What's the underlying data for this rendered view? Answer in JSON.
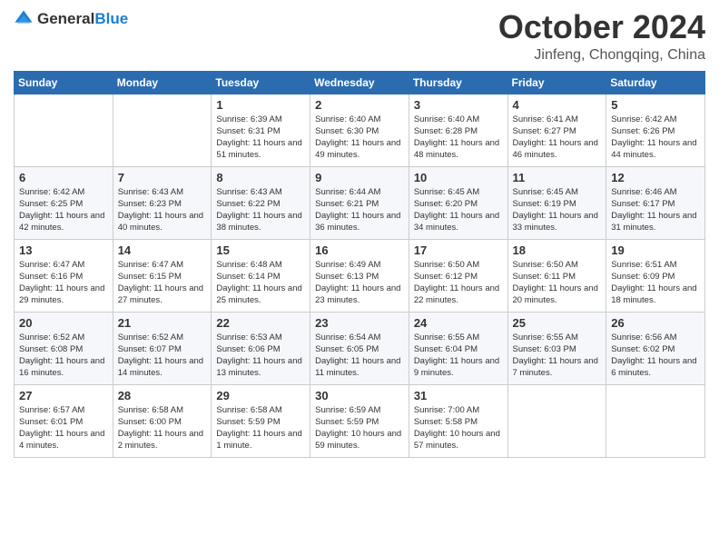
{
  "header": {
    "logo_general": "General",
    "logo_blue": "Blue",
    "title": "October 2024",
    "subtitle": "Jinfeng, Chongqing, China"
  },
  "days_header": [
    "Sunday",
    "Monday",
    "Tuesday",
    "Wednesday",
    "Thursday",
    "Friday",
    "Saturday"
  ],
  "weeks": [
    [
      {
        "day": "",
        "sunrise": "",
        "sunset": "",
        "daylight": ""
      },
      {
        "day": "",
        "sunrise": "",
        "sunset": "",
        "daylight": ""
      },
      {
        "day": "1",
        "sunrise": "Sunrise: 6:39 AM",
        "sunset": "Sunset: 6:31 PM",
        "daylight": "Daylight: 11 hours and 51 minutes."
      },
      {
        "day": "2",
        "sunrise": "Sunrise: 6:40 AM",
        "sunset": "Sunset: 6:30 PM",
        "daylight": "Daylight: 11 hours and 49 minutes."
      },
      {
        "day": "3",
        "sunrise": "Sunrise: 6:40 AM",
        "sunset": "Sunset: 6:28 PM",
        "daylight": "Daylight: 11 hours and 48 minutes."
      },
      {
        "day": "4",
        "sunrise": "Sunrise: 6:41 AM",
        "sunset": "Sunset: 6:27 PM",
        "daylight": "Daylight: 11 hours and 46 minutes."
      },
      {
        "day": "5",
        "sunrise": "Sunrise: 6:42 AM",
        "sunset": "Sunset: 6:26 PM",
        "daylight": "Daylight: 11 hours and 44 minutes."
      }
    ],
    [
      {
        "day": "6",
        "sunrise": "Sunrise: 6:42 AM",
        "sunset": "Sunset: 6:25 PM",
        "daylight": "Daylight: 11 hours and 42 minutes."
      },
      {
        "day": "7",
        "sunrise": "Sunrise: 6:43 AM",
        "sunset": "Sunset: 6:23 PM",
        "daylight": "Daylight: 11 hours and 40 minutes."
      },
      {
        "day": "8",
        "sunrise": "Sunrise: 6:43 AM",
        "sunset": "Sunset: 6:22 PM",
        "daylight": "Daylight: 11 hours and 38 minutes."
      },
      {
        "day": "9",
        "sunrise": "Sunrise: 6:44 AM",
        "sunset": "Sunset: 6:21 PM",
        "daylight": "Daylight: 11 hours and 36 minutes."
      },
      {
        "day": "10",
        "sunrise": "Sunrise: 6:45 AM",
        "sunset": "Sunset: 6:20 PM",
        "daylight": "Daylight: 11 hours and 34 minutes."
      },
      {
        "day": "11",
        "sunrise": "Sunrise: 6:45 AM",
        "sunset": "Sunset: 6:19 PM",
        "daylight": "Daylight: 11 hours and 33 minutes."
      },
      {
        "day": "12",
        "sunrise": "Sunrise: 6:46 AM",
        "sunset": "Sunset: 6:17 PM",
        "daylight": "Daylight: 11 hours and 31 minutes."
      }
    ],
    [
      {
        "day": "13",
        "sunrise": "Sunrise: 6:47 AM",
        "sunset": "Sunset: 6:16 PM",
        "daylight": "Daylight: 11 hours and 29 minutes."
      },
      {
        "day": "14",
        "sunrise": "Sunrise: 6:47 AM",
        "sunset": "Sunset: 6:15 PM",
        "daylight": "Daylight: 11 hours and 27 minutes."
      },
      {
        "day": "15",
        "sunrise": "Sunrise: 6:48 AM",
        "sunset": "Sunset: 6:14 PM",
        "daylight": "Daylight: 11 hours and 25 minutes."
      },
      {
        "day": "16",
        "sunrise": "Sunrise: 6:49 AM",
        "sunset": "Sunset: 6:13 PM",
        "daylight": "Daylight: 11 hours and 23 minutes."
      },
      {
        "day": "17",
        "sunrise": "Sunrise: 6:50 AM",
        "sunset": "Sunset: 6:12 PM",
        "daylight": "Daylight: 11 hours and 22 minutes."
      },
      {
        "day": "18",
        "sunrise": "Sunrise: 6:50 AM",
        "sunset": "Sunset: 6:11 PM",
        "daylight": "Daylight: 11 hours and 20 minutes."
      },
      {
        "day": "19",
        "sunrise": "Sunrise: 6:51 AM",
        "sunset": "Sunset: 6:09 PM",
        "daylight": "Daylight: 11 hours and 18 minutes."
      }
    ],
    [
      {
        "day": "20",
        "sunrise": "Sunrise: 6:52 AM",
        "sunset": "Sunset: 6:08 PM",
        "daylight": "Daylight: 11 hours and 16 minutes."
      },
      {
        "day": "21",
        "sunrise": "Sunrise: 6:52 AM",
        "sunset": "Sunset: 6:07 PM",
        "daylight": "Daylight: 11 hours and 14 minutes."
      },
      {
        "day": "22",
        "sunrise": "Sunrise: 6:53 AM",
        "sunset": "Sunset: 6:06 PM",
        "daylight": "Daylight: 11 hours and 13 minutes."
      },
      {
        "day": "23",
        "sunrise": "Sunrise: 6:54 AM",
        "sunset": "Sunset: 6:05 PM",
        "daylight": "Daylight: 11 hours and 11 minutes."
      },
      {
        "day": "24",
        "sunrise": "Sunrise: 6:55 AM",
        "sunset": "Sunset: 6:04 PM",
        "daylight": "Daylight: 11 hours and 9 minutes."
      },
      {
        "day": "25",
        "sunrise": "Sunrise: 6:55 AM",
        "sunset": "Sunset: 6:03 PM",
        "daylight": "Daylight: 11 hours and 7 minutes."
      },
      {
        "day": "26",
        "sunrise": "Sunrise: 6:56 AM",
        "sunset": "Sunset: 6:02 PM",
        "daylight": "Daylight: 11 hours and 6 minutes."
      }
    ],
    [
      {
        "day": "27",
        "sunrise": "Sunrise: 6:57 AM",
        "sunset": "Sunset: 6:01 PM",
        "daylight": "Daylight: 11 hours and 4 minutes."
      },
      {
        "day": "28",
        "sunrise": "Sunrise: 6:58 AM",
        "sunset": "Sunset: 6:00 PM",
        "daylight": "Daylight: 11 hours and 2 minutes."
      },
      {
        "day": "29",
        "sunrise": "Sunrise: 6:58 AM",
        "sunset": "Sunset: 5:59 PM",
        "daylight": "Daylight: 11 hours and 1 minute."
      },
      {
        "day": "30",
        "sunrise": "Sunrise: 6:59 AM",
        "sunset": "Sunset: 5:59 PM",
        "daylight": "Daylight: 10 hours and 59 minutes."
      },
      {
        "day": "31",
        "sunrise": "Sunrise: 7:00 AM",
        "sunset": "Sunset: 5:58 PM",
        "daylight": "Daylight: 10 hours and 57 minutes."
      },
      {
        "day": "",
        "sunrise": "",
        "sunset": "",
        "daylight": ""
      },
      {
        "day": "",
        "sunrise": "",
        "sunset": "",
        "daylight": ""
      }
    ]
  ]
}
